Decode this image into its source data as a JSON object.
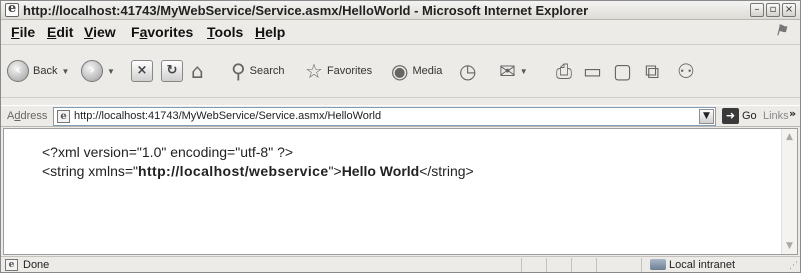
{
  "window": {
    "title": "http://localhost:41743/MyWebService/Service.asmx/HelloWorld - Microsoft Internet Explorer",
    "controls": {
      "minimize": "–",
      "restore": "▫",
      "close": "×"
    }
  },
  "menu": [
    {
      "label": "File",
      "key": "F",
      "rest": "ile"
    },
    {
      "label": "Edit",
      "key": "E",
      "rest": "dit"
    },
    {
      "label": "View",
      "key": "V",
      "rest": "iew"
    },
    {
      "label": "Favorites",
      "pre": "F",
      "key": "a",
      "rest": "vorites"
    },
    {
      "label": "Tools",
      "key": "T",
      "rest": "ools"
    },
    {
      "label": "Help",
      "key": "H",
      "rest": "elp"
    }
  ],
  "toolbar": {
    "back_label": "Back",
    "search_label": "Search",
    "favorites_label": "Favorites",
    "media_label": "Media"
  },
  "address": {
    "label_key": "d",
    "label_pre": "A",
    "label_rest": "dress",
    "url": "http://localhost:41743/MyWebService/Service.asmx/HelloWorld",
    "go_label": "Go",
    "links_label": "Links",
    "links_chevron": "»"
  },
  "content": {
    "xml_declaration": "<?xml version=\"1.0\" encoding=\"utf-8\" ?>",
    "string_open_prefix": "<string xmlns=\"",
    "namespace": "http://localhost/webservice",
    "string_open_suffix": "\">",
    "value": "Hello World",
    "string_close": "</string>"
  },
  "status": {
    "text": "Done",
    "zone": "Local intranet"
  },
  "icons": {
    "app": "ie-page-icon",
    "back": "back-arrow-icon",
    "forward": "forward-arrow-icon",
    "stop": "stop-icon",
    "refresh": "refresh-icon",
    "home": "home-icon",
    "search": "magnifier-icon",
    "favorites": "star-icon",
    "media": "media-icon",
    "history": "history-icon",
    "mail": "mail-icon",
    "print": "printer-icon",
    "edit": "edit-icon",
    "discuss": "discuss-icon",
    "research": "research-icon",
    "messenger": "messenger-icon"
  }
}
